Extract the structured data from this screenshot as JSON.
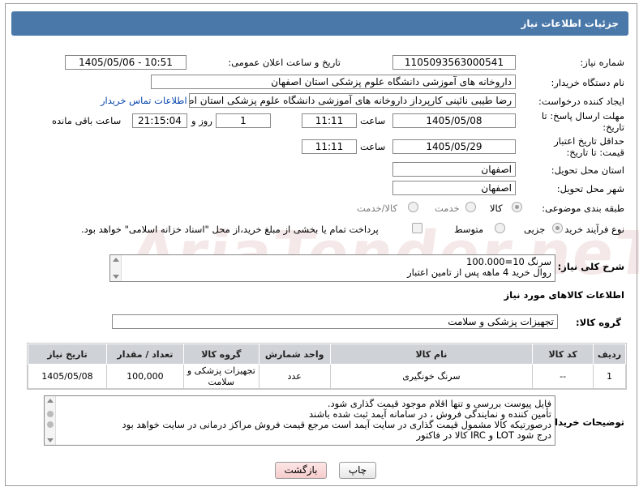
{
  "header": {
    "title": "جزئیات اطلاعات نیاز"
  },
  "watermark": "AriaTender.neT",
  "fields": {
    "need_number_label": "شماره نیاز:",
    "need_number": "1105093563000541",
    "announce_label": "تاریخ و ساعت اعلان عمومی:",
    "announce_value": "1405/05/06 - 10:51",
    "buyer_org_label": "نام دستگاه خریدار:",
    "buyer_org": "داروخانه های آموزشی دانشگاه علوم پزشکی استان اصفهان",
    "creator_label": "ایجاد کننده درخواست:",
    "creator": "رضا طیبی نائینی کارپرداز داروخانه های آموزشی دانشگاه علوم پزشکی استان اصفهان",
    "contact_link": "اطلاعات تماس خریدار",
    "reply_deadline_label": "مهلت ارسال پاسخ: تا تاریخ:",
    "reply_date": "1405/05/08",
    "time_label": "ساعت",
    "reply_time": "11:11",
    "day_label": "روز و",
    "reply_days": "1",
    "remaining_time": "21:15:04",
    "remaining_label": "ساعت باقی مانده",
    "price_deadline_label": "حداقل تاریخ اعتبار قیمت: تا تاریخ:",
    "price_date": "1405/05/29",
    "price_time": "11:11",
    "province_label": "استان محل تحویل:",
    "province": "اصفهان",
    "city_label": "شهر محل تحویل:",
    "city": "اصفهان",
    "category_label": "طبقه بندی موضوعی:",
    "category_options": [
      "کالا",
      "خدمت",
      "کالا/خدمت"
    ],
    "process_label": "نوع فرآیند خرید :",
    "process_options": [
      "جزیی",
      "متوسط"
    ],
    "treasury_note": "پرداخت تمام یا بخشی از مبلغ خرید،از محل \"اسناد خزانه اسلامی\" خواهد بود.",
    "description_label": "شرح کلی نیاز:",
    "description_lines": [
      "سرنگ 10=100.000",
      "روال خرید 4 ماهه پس از تامین اعتبار"
    ],
    "goods_info_title": "اطلاعات کالاهای مورد نیاز",
    "goods_group_label": "گروه کالا:",
    "goods_group": "تجهیزات پزشکی و سلامت",
    "buyer_notes_label": "توضیحات خریدار:",
    "buyer_notes_lines": [
      "فایل پیوست بررسی و تنها اقلام موجود قیمت گذاری شود.",
      "تأمین کننده و نمایندگی فروش ، در سامانه آیمد ثبت شده باشند",
      "درصورتیکه کالا مشمول قیمت گذاری در سایت آیمد است مرجع قیمت فروش مراکز درمانی در سایت خواهد بود",
      "درج شود LOT و IRC کالا در فاکتور"
    ]
  },
  "table": {
    "headers": [
      "ردیف",
      "کد کالا",
      "نام کالا",
      "واحد شمارش",
      "گروه کالا",
      "تعداد / مقدار",
      "تاریخ نیاز"
    ],
    "rows": [
      [
        "1",
        "--",
        "سرنگ خونگیری",
        "عدد",
        "تجهیزات پزشکی و سلامت",
        "100,000",
        "1405/05/08"
      ]
    ]
  },
  "buttons": {
    "print": "چاپ",
    "back": "بازگشت"
  },
  "colors": {
    "title_bg": "#4a78a8",
    "table_header": "#cfd2d6",
    "back_btn": "#f9d6d6"
  }
}
